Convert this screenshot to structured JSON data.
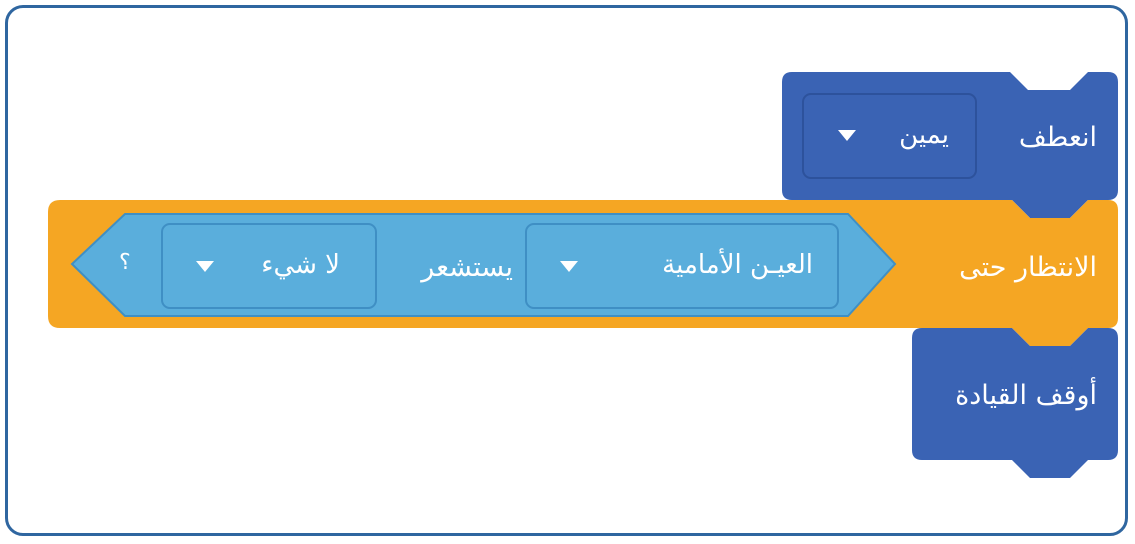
{
  "blocks": {
    "turn": {
      "label": "انعطف",
      "direction_value": "يمين"
    },
    "wait_until": {
      "label": "الانتظار حتى",
      "sensor_value": "العيـن الأمامية",
      "senses_text": "يستشعر",
      "object_value": "لا شيء",
      "question_mark": "؟"
    },
    "stop": {
      "label": "أوقف القيادة"
    }
  },
  "colors": {
    "motion_block": "#3a63b4",
    "control_block": "#f5a623",
    "sensing_block": "#5aaedc",
    "frame_border": "#2f66a0"
  },
  "icons": {
    "dropdown": "caret-down-icon"
  }
}
